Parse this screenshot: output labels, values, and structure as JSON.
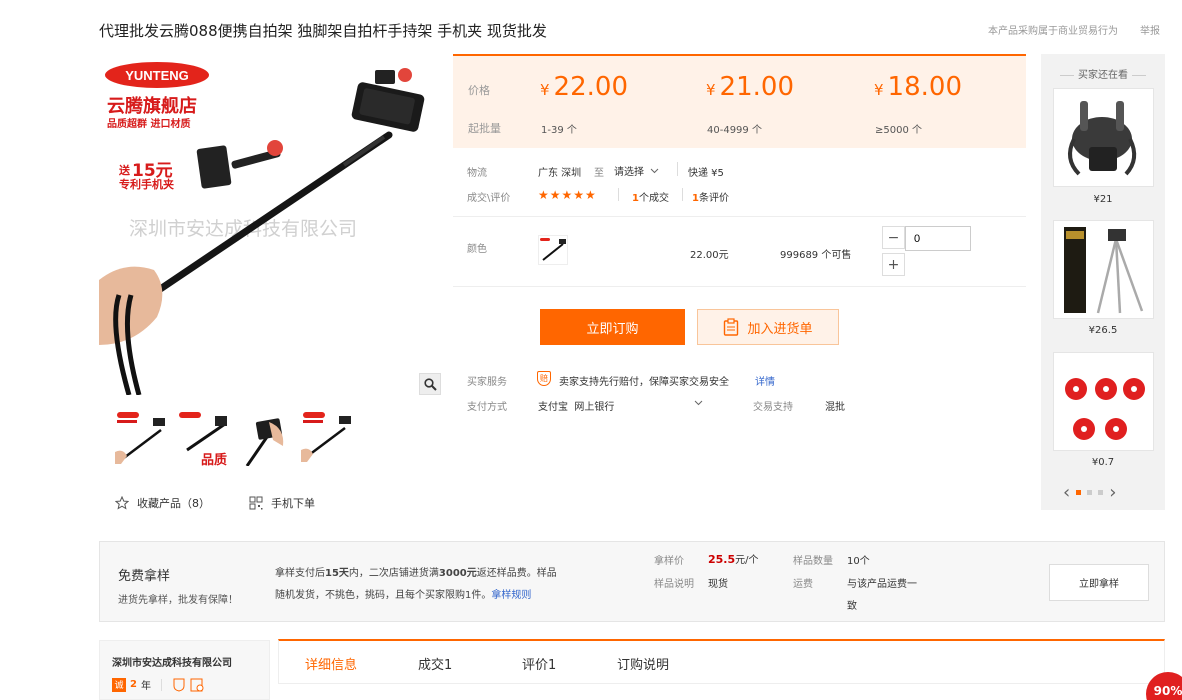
{
  "header": {
    "title": "代理批发云腾088便携自拍架 独脚架自拍杆手持架 手机夹 现货批发",
    "notice": "本产品采购属于商业贸易行为",
    "report": "举报"
  },
  "gallery": {
    "brand": "YUNTENG",
    "store": "云腾旗舰店",
    "slogan": "品质超群 进口材质",
    "promo_prefix": "送",
    "promo_num": "15元",
    "promo_sub": "专利手机夹",
    "watermark": "深圳市安达成科技有限公司",
    "thumb_badge": "品质",
    "favorite": "收藏产品（8）",
    "mobile_order": "手机下单"
  },
  "price_panel": {
    "price_label": "价格",
    "moq_label": "起批量",
    "currency": "¥",
    "tiers": [
      {
        "price": "22.00",
        "range": "1-39 个"
      },
      {
        "price": "21.00",
        "range": "40-4999 个"
      },
      {
        "price": "18.00",
        "range": "≥5000 个"
      }
    ]
  },
  "logistics": {
    "label": "物流",
    "from": "广东 深圳",
    "to_word": "至",
    "to_select": "请选择",
    "express": "快递 ¥5"
  },
  "deals": {
    "label": "成交\\评价",
    "stars": "★★★★★",
    "count_num": "1",
    "count_text": "个成交",
    "review_num": "1",
    "review_text": "条评价"
  },
  "color_row": {
    "label": "颜色",
    "price": "22.00元",
    "stock": "999689 个可售",
    "qty": "0",
    "minus": "−",
    "plus": "+"
  },
  "actions": {
    "order": "立即订购",
    "cart": "加入进货单"
  },
  "service": {
    "label": "买家服务",
    "badge": "赔",
    "text": "卖家支持先行赔付，保障买家交易安全",
    "link": "详情"
  },
  "payment": {
    "label": "支付方式",
    "methods": "支付宝  网上银行",
    "trade_label": "交易支持",
    "trade_value": "混批"
  },
  "rail": {
    "title": "买家还在看",
    "items": [
      {
        "price": "¥21"
      },
      {
        "price": "¥26.5"
      },
      {
        "price": "¥0.7"
      }
    ],
    "prev": "‹",
    "next": "›"
  },
  "sample": {
    "title": "免费拿样",
    "subtitle": "进货先拿样，批发有保障！",
    "desc_a": "拿样支付后",
    "desc_b": "15天",
    "desc_c": "内，二次店铺进货满",
    "desc_d": "3000元",
    "desc_e": "返还样品费。样品",
    "desc_line2": "随机发货，不挑色，挑码，且每个买家限购1件。",
    "rule_link": "拿样规则",
    "price_label": "拿样价",
    "price_value": "25.5",
    "price_unit": "元/个",
    "qty_label": "样品数量",
    "qty_value": "10个",
    "note_label": "样品说明",
    "note_value": "现货",
    "ship_label": "运费",
    "ship_value_1": "与该产品运费一",
    "ship_value_2": "致",
    "button": "立即拿样"
  },
  "company": {
    "name": "深圳市安达成科技有限公司",
    "years_badge": "诚",
    "years": "2",
    "years_unit": "年"
  },
  "tabs": [
    "详细信息",
    "成交1",
    "评价1",
    "订购说明"
  ],
  "progress_badge": "90%",
  "colors": {
    "accent": "#ff6600",
    "panel_bg": "#fff2e8",
    "rail_bg": "#f2f2f2",
    "badge_red": "#e02020"
  }
}
